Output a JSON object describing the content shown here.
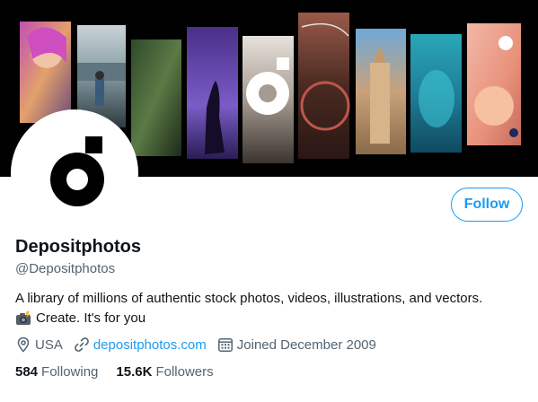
{
  "banner": {
    "description_icon": "photo-collage"
  },
  "profile": {
    "display_name": "Depositphotos",
    "handle": "@Depositphotos",
    "bio_line1": "A library of millions of authentic stock photos, videos, illustrations, and vectors.",
    "bio_line2": "Create. It's for you",
    "bio_emoji_icon": "camera-flash-icon"
  },
  "meta": {
    "location": "USA",
    "website": "depositphotos.com",
    "joined": "Joined December 2009"
  },
  "stats": {
    "following_count": "584",
    "following_label": "Following",
    "followers_count": "15.6K",
    "followers_label": "Followers"
  },
  "actions": {
    "follow_label": "Follow"
  },
  "colors": {
    "accent": "#1d9bf0",
    "text_primary": "#0f1419",
    "text_secondary": "#536471"
  }
}
